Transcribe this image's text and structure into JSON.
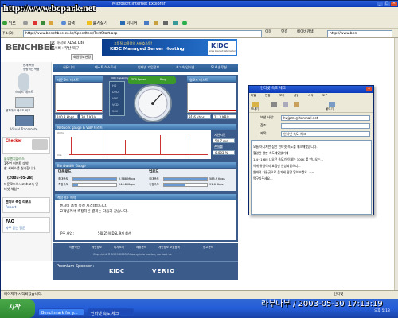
{
  "overlay": {
    "url_banner": "http://www.bcpark.net"
  },
  "browser": {
    "window_title": "Microsoft Internet Explorer",
    "menu": [
      "뒤로",
      "앞으로",
      "검색",
      "즐겨찾기",
      "미디어"
    ],
    "menu_right": [
      "파일",
      "편집",
      "보기"
    ],
    "address_label": "주소(D)",
    "address_value": "http://www.benchbee.co.kr/Speedtest/TestStart.asp",
    "go_label": "이동",
    "links_label": "연결",
    "search_label": "네이버검색",
    "address2_value": "http://www.ben",
    "status_text": "페이지가 시작되었습니다.",
    "zone_text": "인터넷"
  },
  "site": {
    "logo": "BENCHBEE",
    "user_line1": "ID: 하나로 ADSL Lite",
    "user_line2": "IP 서버 : 부산 북구",
    "reset_label": "회원정보변경",
    "ad_line1": "고품질 고용량의 서버호스팅!",
    "ad_line2": "KIDC Managed Server Hosting",
    "ad_logo": "KIDC",
    "ad_sub": "Korea Internet Data Center",
    "nav": [
      "커뮤니티",
      "테스트 히스토리",
      "인터넷 가입정보",
      "초고속 인터넷",
      "SLA 솔루션"
    ],
    "side": {
      "item1": "현재 측정",
      "item2": "정량적인 측정",
      "speed_test_label": "스피드 테스트",
      "bench_label": "벤치마크 테스트 비교",
      "visual_label": "Visual Traceroute",
      "checker_title": "Checker",
      "checker_sub": "네트워크 품질 체크",
      "news1": "블루벤치플러스",
      "news2": "1주년 이벤트 대박!",
      "news3": "한 서비스를 실시합니다",
      "event_date": "(2003-05-28)",
      "event_text1": "다운로드하시고 초고속 인",
      "event_text2": "터넷 체험~",
      "report_title": "벤치비 측정 리포트",
      "report_sub": "Report",
      "faq_title": "FAQ",
      "faq_sub": "자주 묻는 질문"
    },
    "download": {
      "title": "다운로드 테스트",
      "value1": "240.8 kbps",
      "value2": "30.1 KB/s"
    },
    "upload": {
      "title": "업로드 테스트",
      "value1": "91.6 kbps",
      "value2": "11.3 KB/s"
    },
    "vod": {
      "title": "VOD Capability",
      "items": [
        "HD",
        "DVD",
        "VHS",
        "VCD",
        "56K"
      ],
      "gauge_labels": [
        "TCP Speed",
        "Ping"
      ]
    },
    "ping": {
      "title": "Network gauge & VoIP 테스트",
      "axis_top": "500ms",
      "axis_bottom": "0ms",
      "latency_label": "지연시간",
      "latency_value": "54.7 ms",
      "loss_label": "손실률",
      "loss_value": "0.003 %"
    },
    "bandwidth": {
      "title": "Bandwidth Gauge",
      "dl_label": "다운로드",
      "dl_rows": [
        {
          "label": "최대속도",
          "value": "2,588 Mbps"
        },
        {
          "label": "측정속도",
          "value": "240.8 Kbps"
        }
      ],
      "ul_label": "업로드",
      "ul_rows": [
        {
          "label": "최대속도",
          "value": "585.9 Kbps"
        },
        {
          "label": "측정속도",
          "value": "91.6 Kbps"
        }
      ],
      "dl_bar_fraction": 0.12,
      "ul_bar_fraction": 0.5
    },
    "result": {
      "title": "측정결과 해석",
      "text1": "벤치비 품질 측정 시스템입니다.",
      "text2": "고객님께서 측정하신 결과는 다음과 같습니다.",
      "footer_label": "IP주 사업 :",
      "footer_value": "5월 25일    DSL 9개 회선"
    },
    "footer_links": [
      "이용약관",
      "개인정보",
      "회사소개",
      "제휴문의",
      "개인정보 보호정책",
      "광고문의"
    ],
    "copyright": "Copyright © 1999-2003 Ohoong information, contact us",
    "sponsor_label": "Premium Sponsor :",
    "sponsor1": "KIDC",
    "sponsor2": "VERIO"
  },
  "mail": {
    "title": "인터넷 속도 체크",
    "menu": [
      "파일",
      "편집",
      "보기",
      "삽입",
      "서식",
      "도구"
    ],
    "toolbar": [
      "보내기",
      "잘라내기",
      "복사",
      "붙이기"
    ],
    "from_label": "보낸 사람:",
    "from_value": "hwjpms@hanmail.net",
    "cc_label": "참조:",
    "subject_label": "제목:",
    "subject_value": "인터넷 속도 체크",
    "body": [
      "오늘 아니지만 잠깐 인터넷 속도를 체크해봤습니다.",
      "헐엉한 평판 속도레였었기에~~~",
      "1.4~1.6M 나오던 속도가 이제는 300K 를 안나오는...",
      "이게 유령이지 요금만 인상되었으니...",
      "원래의 다른곳으로 옮기세 됨당 알아보겠요..~~",
      "먹구리주세요..."
    ]
  },
  "taskbar": {
    "start": "시작",
    "items": [
      "Benchmark for y...",
      "인터넷 속도 체크"
    ],
    "clock": "라부나부 / 2003-05-30 17:13:19",
    "time": "오후 5:13"
  }
}
